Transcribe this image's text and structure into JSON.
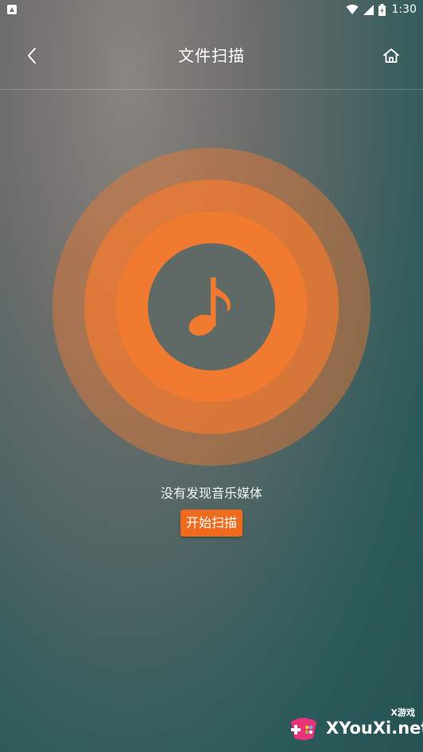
{
  "status_bar": {
    "time": "1:30"
  },
  "header": {
    "title": "文件扫描",
    "back_icon": "chevron-left-icon",
    "home_icon": "home-icon"
  },
  "scanner": {
    "center_icon": "music-note-icon",
    "ring_color": "#f07a30",
    "message": "没有发现音乐媒体",
    "button_label": "开始扫描",
    "button_color": "#ee6a1c"
  },
  "watermark": {
    "brand_text": "XYouXi.net",
    "small_label": "X游戏"
  }
}
